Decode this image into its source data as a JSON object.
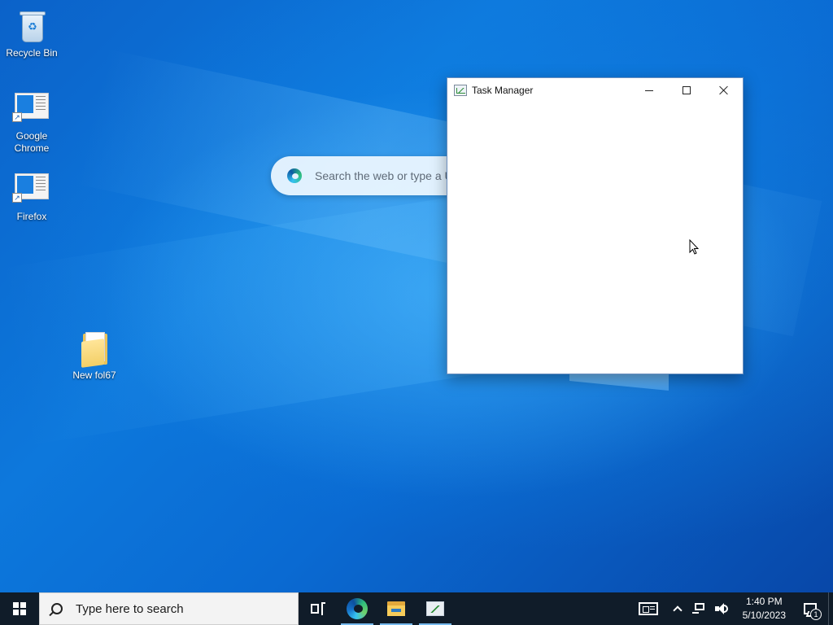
{
  "desktop": {
    "icons": [
      {
        "label": "Recycle Bin",
        "icon": "recycle-bin-icon"
      },
      {
        "label": "Google Chrome",
        "icon": "app-shortcut-icon"
      },
      {
        "label": "Firefox",
        "icon": "app-shortcut-icon"
      },
      {
        "label": "New fol67",
        "icon": "folder-icon"
      }
    ],
    "edge_search": {
      "placeholder": "Search the web or type a U",
      "icon": "edge-icon"
    }
  },
  "task_manager": {
    "title": "Task Manager",
    "icon": "task-manager-icon",
    "controls": [
      "minimize",
      "maximize",
      "close"
    ]
  },
  "taskbar": {
    "search_placeholder": "Type here to search",
    "pinned": [
      {
        "name": "Task View",
        "icon": "task-view-icon"
      },
      {
        "name": "Microsoft Edge",
        "icon": "edge-icon",
        "running": true
      },
      {
        "name": "File Explorer",
        "icon": "file-explorer-icon",
        "running": true
      },
      {
        "name": "Task Manager",
        "icon": "task-manager-icon",
        "running": true
      }
    ],
    "tray": {
      "time": "1:40 PM",
      "date": "5/10/2023",
      "notification_count": "1"
    }
  },
  "colors": {
    "taskbar_bg": "#101c29",
    "wallpaper_blue": "#0b62c9",
    "running_indicator": "#76b9ed"
  }
}
